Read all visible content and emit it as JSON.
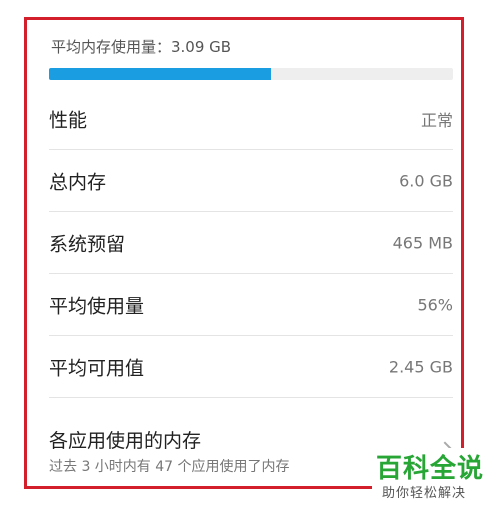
{
  "usage": {
    "label": "平均内存使用量：3.09 GB",
    "fraction": 0.55
  },
  "rows": [
    {
      "label": "性能",
      "value": "正常"
    },
    {
      "label": "总内存",
      "value": "6.0 GB"
    },
    {
      "label": "系统预留",
      "value": "465 MB"
    },
    {
      "label": "平均使用量",
      "value": "56%"
    },
    {
      "label": "平均可用值",
      "value": "2.45 GB"
    }
  ],
  "apps": {
    "title": "各应用使用的内存",
    "subtitle": "过去 3 小时内有 47 个应用使用了内存"
  },
  "watermark": {
    "title": "百科全说",
    "subtitle": "助你轻松解决"
  },
  "colors": {
    "accent": "#1a9ee1",
    "frame": "#d21f2b",
    "watermark": "#27a535"
  }
}
